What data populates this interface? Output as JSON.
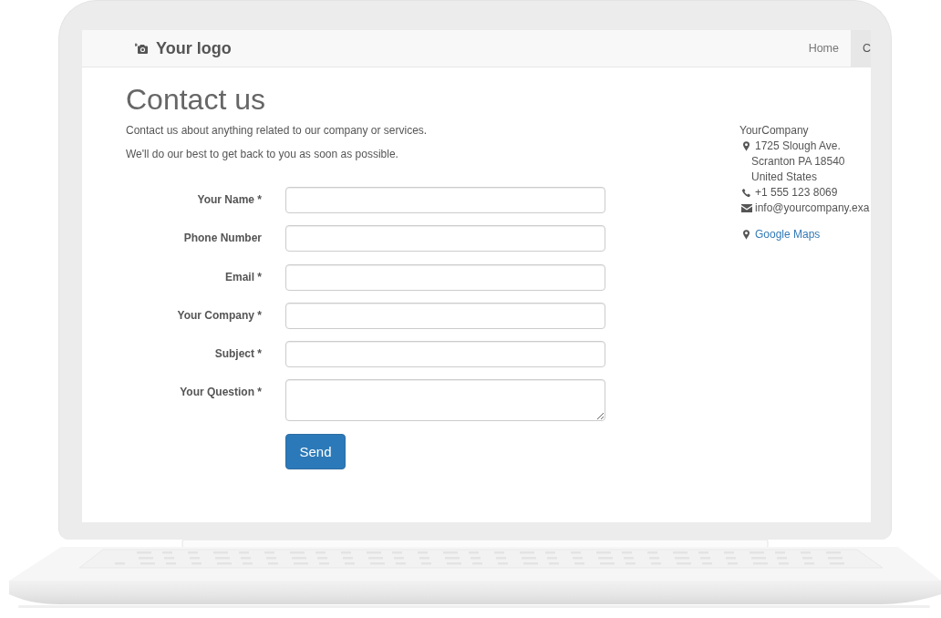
{
  "navbar": {
    "logo": "Your logo",
    "items": [
      {
        "label": "Home",
        "selected": false
      },
      {
        "label": "C",
        "selected": true
      }
    ]
  },
  "page": {
    "title": "Contact us",
    "intro": [
      "Contact us about anything related to our company or services.",
      "We'll do our best to get back to you as soon as possible."
    ]
  },
  "form": {
    "fields": [
      {
        "label": "Your Name *",
        "kind": "input"
      },
      {
        "label": "Phone Number",
        "kind": "input"
      },
      {
        "label": "Email *",
        "kind": "input"
      },
      {
        "label": "Your Company *",
        "kind": "input"
      },
      {
        "label": "Subject *",
        "kind": "input"
      },
      {
        "label": "Your Question *",
        "kind": "textarea"
      }
    ],
    "submit": "Send"
  },
  "contact": {
    "company": "YourCompany",
    "address": [
      "1725 Slough Ave.",
      "Scranton PA 18540",
      "United States"
    ],
    "phone": "+1 555 123 8069",
    "email": "info@yourcompany.exa",
    "map_link": "Google Maps"
  }
}
